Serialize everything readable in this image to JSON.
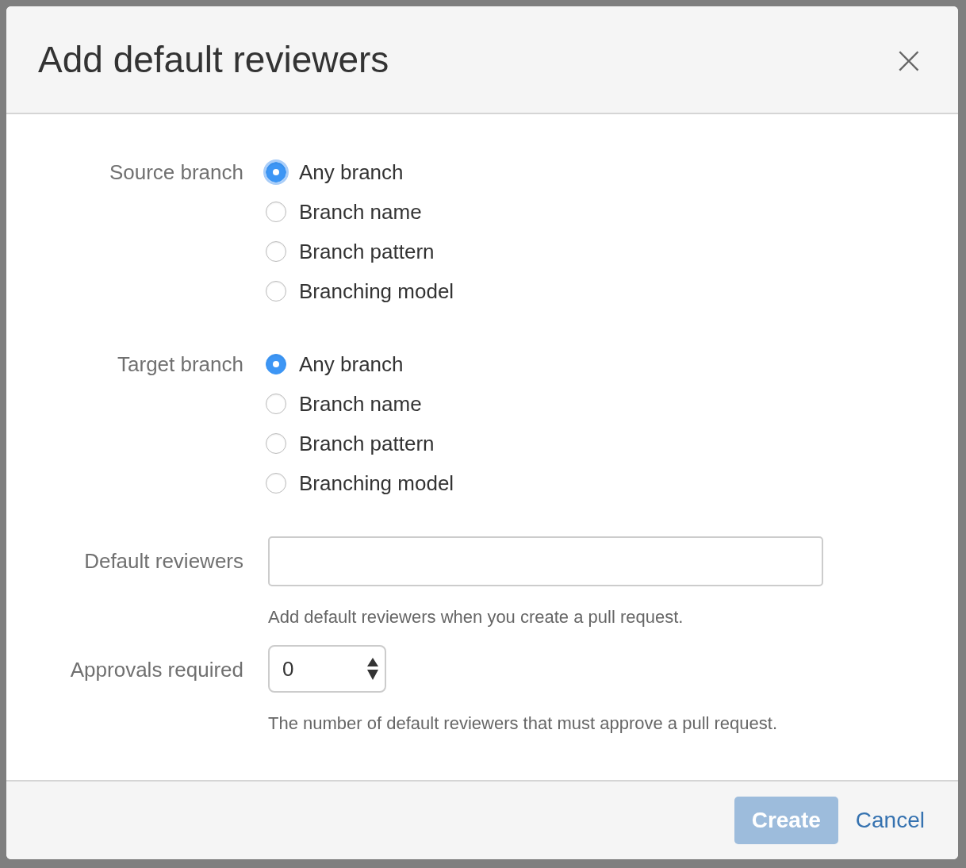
{
  "dialog": {
    "title": "Add default reviewers",
    "close": "×"
  },
  "branch_groups": [
    {
      "label": "Source branch",
      "focused": true,
      "options": [
        {
          "label": "Any branch",
          "selected": true
        },
        {
          "label": "Branch name",
          "selected": false
        },
        {
          "label": "Branch pattern",
          "selected": false
        },
        {
          "label": "Branching model",
          "selected": false
        }
      ]
    },
    {
      "label": "Target branch",
      "focused": false,
      "options": [
        {
          "label": "Any branch",
          "selected": true
        },
        {
          "label": "Branch name",
          "selected": false
        },
        {
          "label": "Branch pattern",
          "selected": false
        },
        {
          "label": "Branching model",
          "selected": false
        }
      ]
    }
  ],
  "fields": [
    {
      "kind": "text",
      "label": "Default reviewers",
      "help": "Add default reviewers when you create a pull request."
    },
    {
      "kind": "select",
      "label": "Approvals required",
      "value": "0",
      "help": "The number of default reviewers that must approve a pull request."
    }
  ],
  "buttons": [
    {
      "kind": "primary",
      "label": "Create",
      "disabled": true
    },
    {
      "kind": "link",
      "label": "Cancel",
      "disabled": false
    }
  ]
}
